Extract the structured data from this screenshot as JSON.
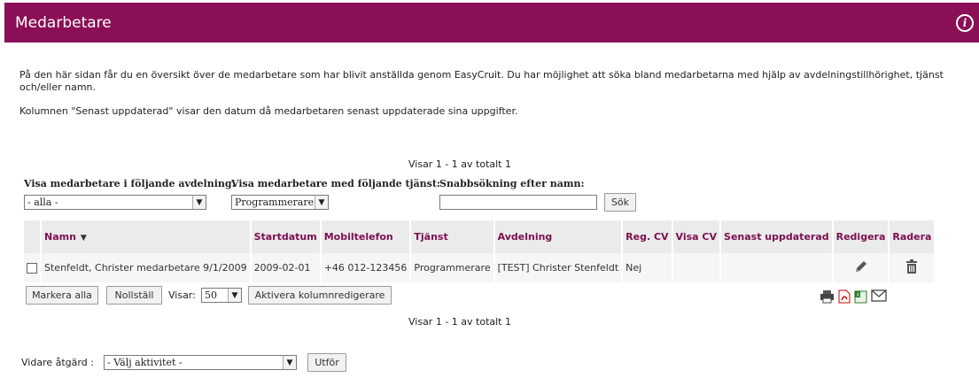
{
  "header": {
    "title": "Medarbetare",
    "info_icon": "info-icon"
  },
  "intro": {
    "paragraph1": "På den här sidan får du en översikt över de medarbetare som har blivit anställda genom EasyCruit. Du har möjlighet att söka bland medarbetarna med hjälp av avdelningstillhörighet, tjänst och/eller namn.",
    "paragraph2": "Kolumnen \"Senast uppdaterad\" visar den datum då medarbetaren senast uppdaterade sina uppgifter."
  },
  "counter_text": "Visar 1 - 1 av totalt 1",
  "filters": {
    "department": {
      "label": "Visa medarbetare i följande avdelning:",
      "value": "- alla -"
    },
    "role": {
      "label": "Visa medarbetare med följande tjänst:",
      "value": "Programmerare"
    },
    "search": {
      "label": "Snabbsökning efter namn:",
      "value": "",
      "button": "Sök"
    }
  },
  "table": {
    "columns": [
      "Namn",
      "Startdatum",
      "Mobiltelefon",
      "Tjänst",
      "Avdelning",
      "Reg. CV",
      "Visa CV",
      "Senast uppdaterad",
      "Redigera",
      "Radera"
    ],
    "rows": [
      {
        "name": "Stenfeldt, Christer medarbetare 9/1/2009",
        "start": "2009-02-01",
        "mobile": "+46 012-123456",
        "role": "Programmerare",
        "department": "[TEST] Christer Stenfeldt",
        "reg_cv": "Nej",
        "show_cv": "",
        "updated": ""
      }
    ]
  },
  "controls": {
    "select_all": "Markera alla",
    "reset": "Nollställ",
    "show_label": "Visar:",
    "page_size": "50",
    "activate_editor": "Aktivera kolumnredigerare"
  },
  "action": {
    "label": "Vidare åtgärd :",
    "select_value": "- Välj aktivitet -",
    "button": "Utför"
  },
  "colors": {
    "header": "#8a0f57",
    "column_header_text": "#7b0f4f",
    "table_header_bg": "#ebebeb"
  }
}
